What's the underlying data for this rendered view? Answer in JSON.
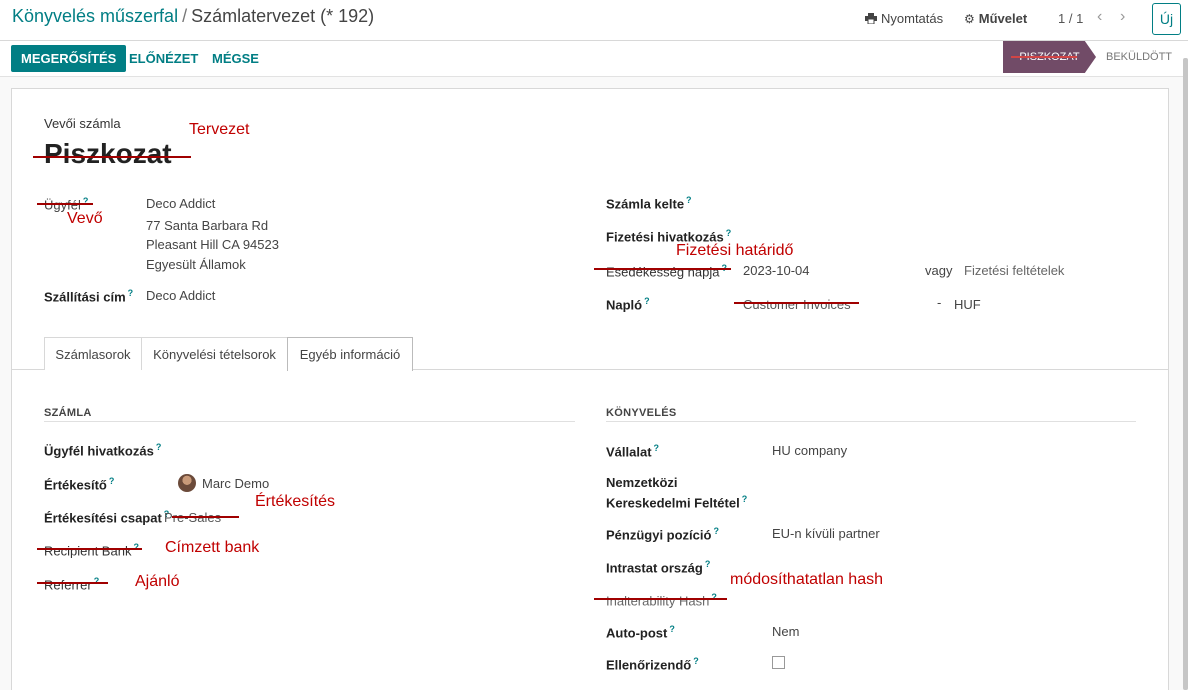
{
  "header": {
    "breadcrumb_root": "Könyvelés műszerfal",
    "breadcrumb_sep": "/",
    "breadcrumb_current": "Számlatervezet (* 192)",
    "print_label": "Nyomtatás",
    "action_label": "Művelet",
    "pager": "1 / 1",
    "new_label": "Új"
  },
  "statusbar": {
    "confirm": "MEGERŐSÍTÉS",
    "preview": "ELŐNÉZET",
    "cancel": "MÉGSE",
    "stage_active": "PISZKOZAT",
    "stage_next": "BEKÜLDÖTT"
  },
  "form": {
    "doc_type": "Vevői számla",
    "title": "Piszkozat",
    "customer_label": "Ügyfél",
    "customer_name": "Deco Addict",
    "address_line1": "77 Santa Barbara Rd",
    "address_line2": "Pleasant Hill CA 94523",
    "address_line3": "Egyesült Államok",
    "shipping_label": "Szállítási cím",
    "shipping_value": "Deco Addict",
    "invoice_date_label": "Számla kelte",
    "payment_ref_label": "Fizetési hivatkozás",
    "due_date_label": "Esedékesség napja",
    "due_date_value": "2023-10-04",
    "or_label": "vagy",
    "payment_terms": "Fizetési feltételek",
    "journal_label": "Napló",
    "journal_value": "Customer Invoices",
    "journal_dash": "-",
    "currency": "HUF"
  },
  "annotations": {
    "title": "Tervezet",
    "customer": "Vevő",
    "due_date": "Fizetési határidő",
    "sales_team": "Értékesítés",
    "recipient_bank": "Címzett bank",
    "referrer": "Ajánló",
    "hash": "módosíthatatlan hash"
  },
  "tabs": [
    {
      "label": "Számlasorok"
    },
    {
      "label": "Könyvelési tételsorok"
    },
    {
      "label": "Egyéb információ"
    }
  ],
  "invoice_section": {
    "title": "SZÁMLA",
    "customer_ref_label": "Ügyfél hivatkozás",
    "salesperson_label": "Értékesítő",
    "salesperson_value": "Marc Demo",
    "sales_team_label": "Értékesítési csapat",
    "sales_team_value": "Pre-Sales",
    "recipient_bank_label": "Recipient Bank",
    "referrer_label": "Referrer"
  },
  "accounting_section": {
    "title": "KÖNYVELÉS",
    "company_label": "Vállalat",
    "company_value": "HU company",
    "incoterm_label_line1": "Nemzetközi",
    "incoterm_label_line2": "Kereskedelmi Feltétel",
    "fiscal_position_label": "Pénzügyi pozíció",
    "fiscal_position_value": "EU-n kívüli partner",
    "intrastat_label": "Intrastat ország",
    "hash_label": "Inalterability Hash",
    "autopost_label": "Auto-post",
    "autopost_value": "Nem",
    "to_check_label": "Ellenőrizendő"
  },
  "help_mark": "?",
  "icons": {
    "print": "printer-icon",
    "action": "gear-icon",
    "prev": "chevron-left-icon",
    "next": "chevron-right-icon"
  },
  "colors": {
    "primary": "#017e84",
    "stage": "#714b67",
    "annotation": "#c00000"
  }
}
